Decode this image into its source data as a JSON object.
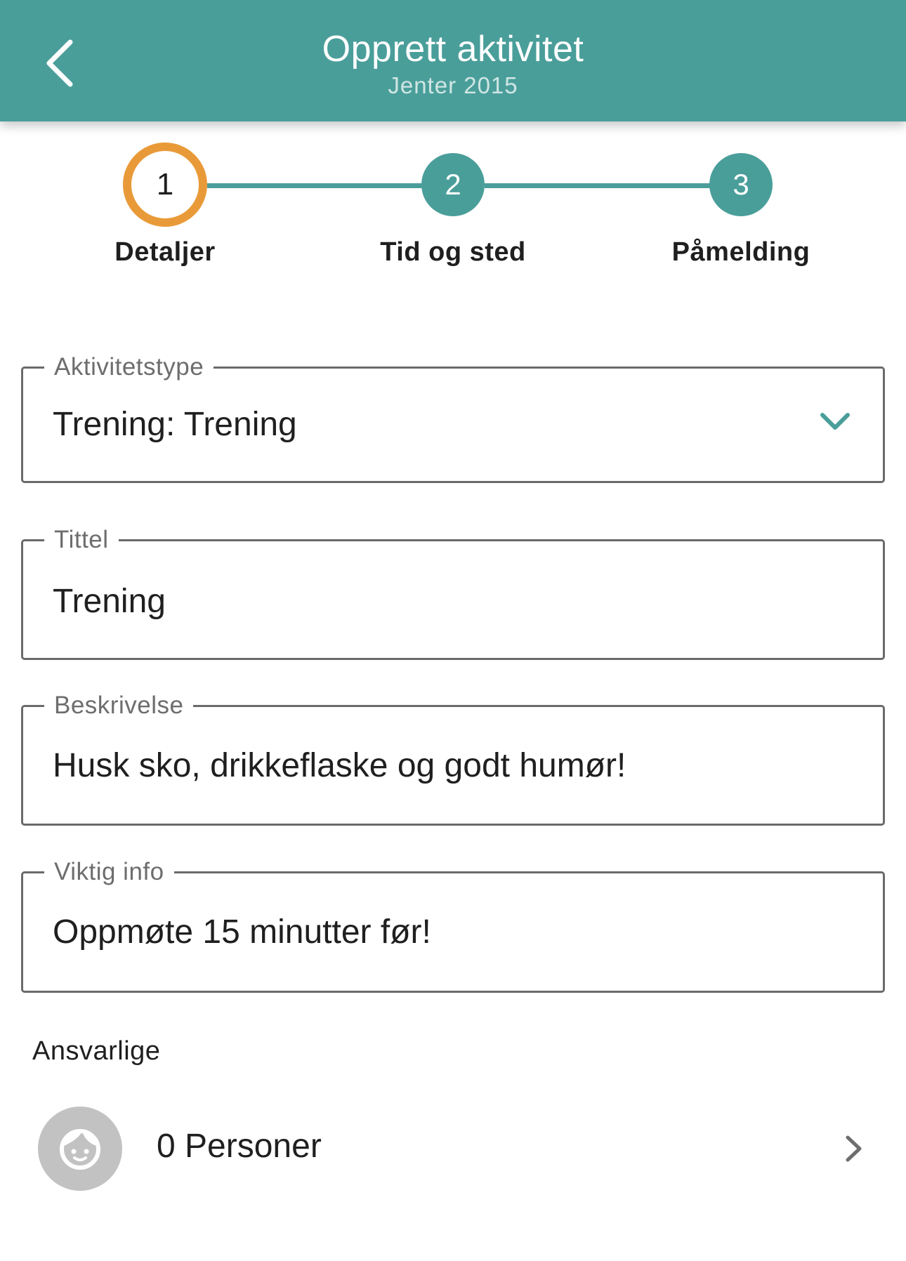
{
  "header": {
    "title": "Opprett aktivitet",
    "subtitle": "Jenter 2015",
    "back_icon": "chevron-left-icon",
    "background": "#4a9e9a"
  },
  "stepper": {
    "steps": [
      {
        "number": "1",
        "label": "Detaljer",
        "state": "active"
      },
      {
        "number": "2",
        "label": "Tid og sted",
        "state": "upcoming"
      },
      {
        "number": "3",
        "label": "Påmelding",
        "state": "upcoming"
      }
    ],
    "active_color": "#e99a38",
    "line_color": "#4a9e9a"
  },
  "form": {
    "activity_type": {
      "label": "Aktivitetstype",
      "value": "Trening: Trening",
      "icon": "chevron-down-icon"
    },
    "title": {
      "label": "Tittel",
      "value": "Trening"
    },
    "description": {
      "label": "Beskrivelse",
      "value": "Husk sko, drikkeflaske og godt humør!"
    },
    "important_info": {
      "label": "Viktig info",
      "value": "Oppmøte 15 minutter før!"
    }
  },
  "responsible": {
    "section_title": "Ansvarlige",
    "count_label": "0 Personer",
    "avatar_icon": "face-icon",
    "arrow_icon": "chevron-right-icon"
  }
}
